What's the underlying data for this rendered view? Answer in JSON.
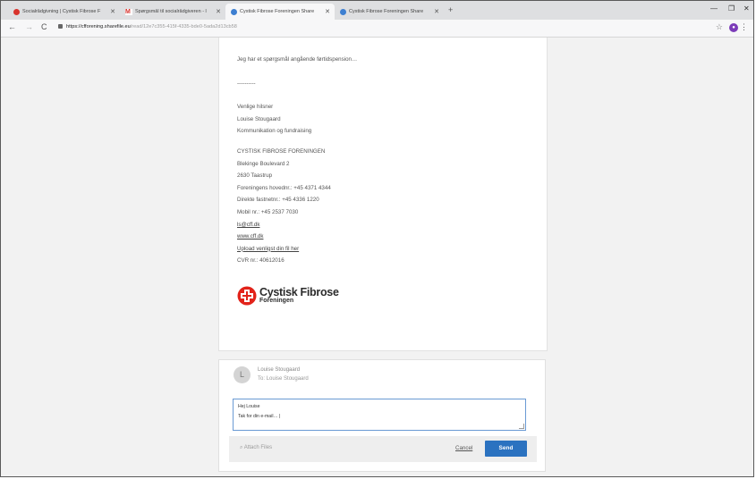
{
  "browser": {
    "tabs": [
      {
        "label": "Socialrådgivning | Cystisk Fibrose F",
        "icon": "cff-favicon-icon",
        "color": "#d8332d"
      },
      {
        "label": "Spørgsmål til socialrådgiveren - l",
        "icon": "gmail-icon",
        "color": "#d8332d"
      },
      {
        "label": "Cystisk Fibrose Foreningen Share",
        "icon": "sharefile-icon",
        "color": "#3d7fd1"
      },
      {
        "label": "Cystisk Fibrose Foreningen Share",
        "icon": "sharefile-icon",
        "color": "#3d7fd1"
      }
    ],
    "url_host": "https://cfforening.sharefile.eu",
    "url_path": "/read/12e7c355-415f-4335-bde0-5ada2d13cb58"
  },
  "message": {
    "question": "Jeg har et spørgsmål angående førtidspension…",
    "divider": "----------",
    "greeting": "Venlige hilsner",
    "sender_name": "Louise Stougaard",
    "sender_role": "Kommunikation og fundraising",
    "org_name": "CYSTISK FIBROSE FORENINGEN",
    "address1": "Blekinge Boulevard 2",
    "address2": "2630 Taastrup",
    "phone_main": "Foreningens hovednr.: +45 4371 4344",
    "phone_direct": "Direkte fastnetnr.: +45 4336 1220",
    "phone_mobile": "Mobil nr.: +45 2537 7030",
    "email": "ls@cff.dk",
    "website": "www.cff.dk",
    "upload_link": "Upload venligst din fil her",
    "cvr": "CVR nr.: 40612016",
    "logo": {
      "line1": "Cystisk Fibrose",
      "line2": "Foreningen",
      "color": "#e2231a"
    }
  },
  "reply": {
    "avatar_letter": "L",
    "from": "Louise Stougaard",
    "to": "To: Louise Stougaard",
    "line1": "Hej Louise",
    "line2": "Tak for din e-mail… |",
    "attach_label": "Attach Files",
    "cancel_label": "Cancel",
    "send_label": "Send",
    "send_color": "#2b72c0"
  }
}
